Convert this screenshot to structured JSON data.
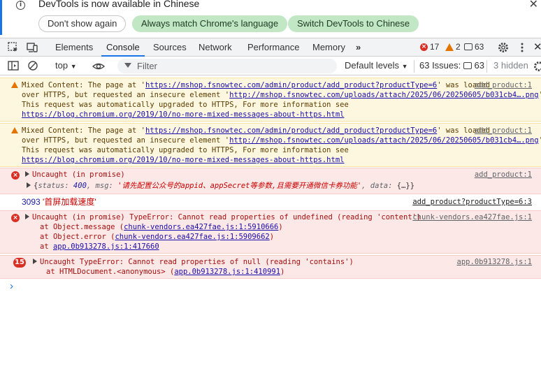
{
  "infobar": {
    "message": "DevTools is now available in Chinese",
    "btn_dont_show": "Don't show again",
    "btn_always_match": "Always match Chrome's language",
    "btn_switch": "Switch DevTools to Chinese"
  },
  "tabs": [
    {
      "label": "Elements"
    },
    {
      "label": "Console"
    },
    {
      "label": "Sources"
    },
    {
      "label": "Network"
    },
    {
      "label": "Performance"
    },
    {
      "label": "Memory"
    }
  ],
  "counts": {
    "errors": "17",
    "warnings": "2",
    "messages": "63"
  },
  "toolbar": {
    "context": "top",
    "filter_placeholder": "Filter",
    "levels": "Default levels",
    "issues_label": "63 Issues:",
    "issues_count": "63",
    "hidden": "3 hidden"
  },
  "logs": {
    "warn1": {
      "l1_pre": "Mixed Content: The page at '",
      "l1_url": "https://mshop.fsnowtec.com/admin/product/add_product?productType=6",
      "l1_post": "' was loaded",
      "l2_pre": "over HTTPS, but requested an insecure element '",
      "l2_url": "http://mshop.fsnowtec.com/uploads/attach/2025/06/20250605/b031cb4….png",
      "l2_post": "'.",
      "l3": "This request was automatically upgraded to HTTPS, For more information see",
      "l4_url": "https://blog.chromium.org/2019/10/no-more-mixed-messages-about-https.html",
      "source": "add_product:1"
    },
    "warn2": {
      "l1_pre": "Mixed Content: The page at '",
      "l1_url": "https://mshop.fsnowtec.com/admin/product/add_product?productType=6",
      "l1_post": "' was loaded",
      "l2_pre": "over HTTPS, but requested an insecure element '",
      "l2_url": "http://mshop.fsnowtec.com/uploads/attach/2025/06/20250605/b031cb4….png",
      "l2_post": "'.",
      "l3": "This request was automatically upgraded to HTTPS, For more information see",
      "l4_url": "https://blog.chromium.org/2019/10/no-more-mixed-messages-about-https.html",
      "source": "add_product:1"
    },
    "err1": {
      "title": "Uncaught (in promise)",
      "obj_open": "{",
      "k_status": "status",
      "v_status": "400",
      "k_msg": "msg",
      "v_msg": "'请先配置公众号的appid、appSecret等参数,且需要开通微信卡券功能'",
      "k_data": "data",
      "v_data": "{…}}",
      "source": "add_product:1"
    },
    "log1": {
      "num": "3093",
      "text": "'首屏加载速度'",
      "source": "add_product?productType=6:3"
    },
    "err2": {
      "title": "Uncaught (in promise) TypeError: Cannot read properties of undefined (reading 'content')",
      "s1_pre": "at Object.message (",
      "s1_link": "chunk-vendors.ea427fae.js:1:5910666",
      "s2_pre": "at Object.error (",
      "s2_link": "chunk-vendors.ea427fae.js:1:5909662",
      "s3_pre": "at ",
      "s3_link": "app.0b913278.js:1:417660",
      "close": ")",
      "source": "chunk-vendors.ea427fae.js:1"
    },
    "err3": {
      "count": "15",
      "title": "Uncaught TypeError: Cannot read properties of null (reading 'contains')",
      "s1_pre": "at HTMLDocument.<anonymous> (",
      "s1_link": "app.0b913278.js:1:410991",
      "close": ")",
      "source": "app.0b913278.js:1"
    },
    "prompt": "›"
  },
  "colors": {
    "accent": "#1a73e8",
    "error": "#d93025",
    "warning": "#e37400",
    "pill_green": "#c2e7c5"
  }
}
